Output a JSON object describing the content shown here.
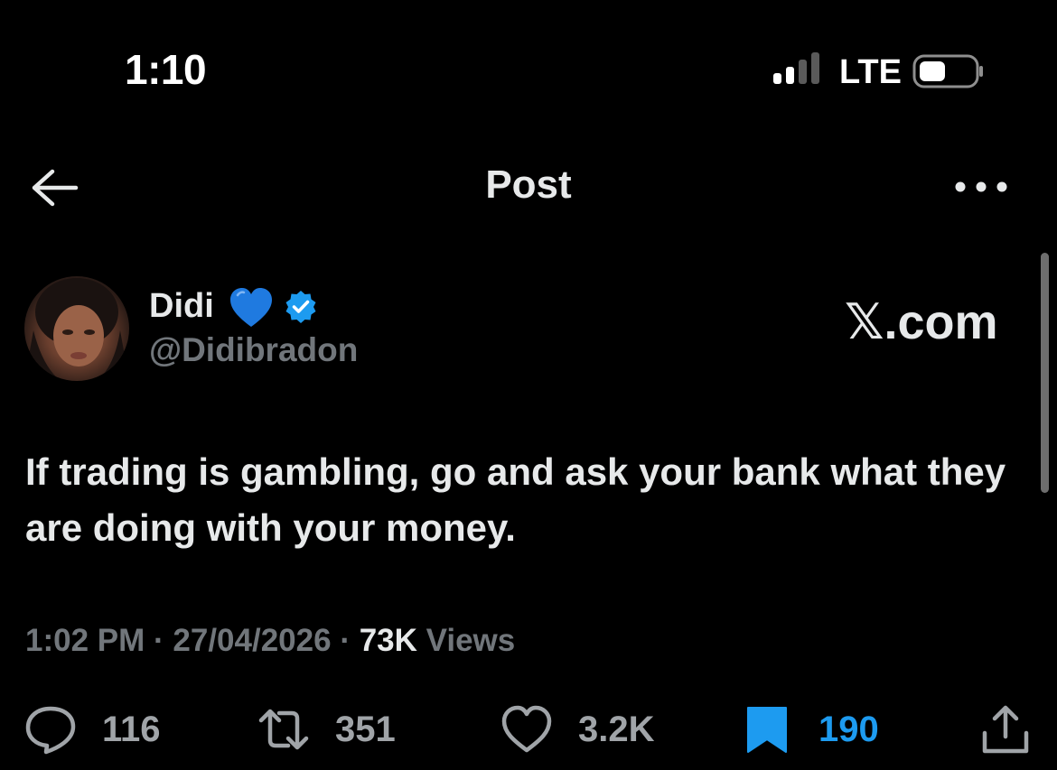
{
  "status_bar": {
    "time": "1:10",
    "network": "LTE",
    "icons": [
      "signal-icon",
      "battery-icon"
    ]
  },
  "header": {
    "title": "Post",
    "back_icon": "arrow-left-icon",
    "more_icon": "more-horizontal-icon"
  },
  "author": {
    "name": "Didi",
    "name_emoji": "blue-heart-icon",
    "verified_icon": "verified-badge-icon",
    "handle": "@Didibradon"
  },
  "watermark": "𝕏.com",
  "post": {
    "text": "If trading is gambling, go and ask your bank what they are doing with your money."
  },
  "meta": {
    "time": "1:02 PM",
    "separator": "·",
    "date": "27/04/2026",
    "views_count": "73K",
    "views_label": "Views"
  },
  "actions": {
    "replies": "116",
    "reposts": "351",
    "likes": "3.2K",
    "bookmarks": "190",
    "share_icon": "share-icon"
  },
  "colors": {
    "background": "#000000",
    "text_primary": "#e7e9ea",
    "text_secondary": "#71767b",
    "accent": "#1d9bf0"
  }
}
